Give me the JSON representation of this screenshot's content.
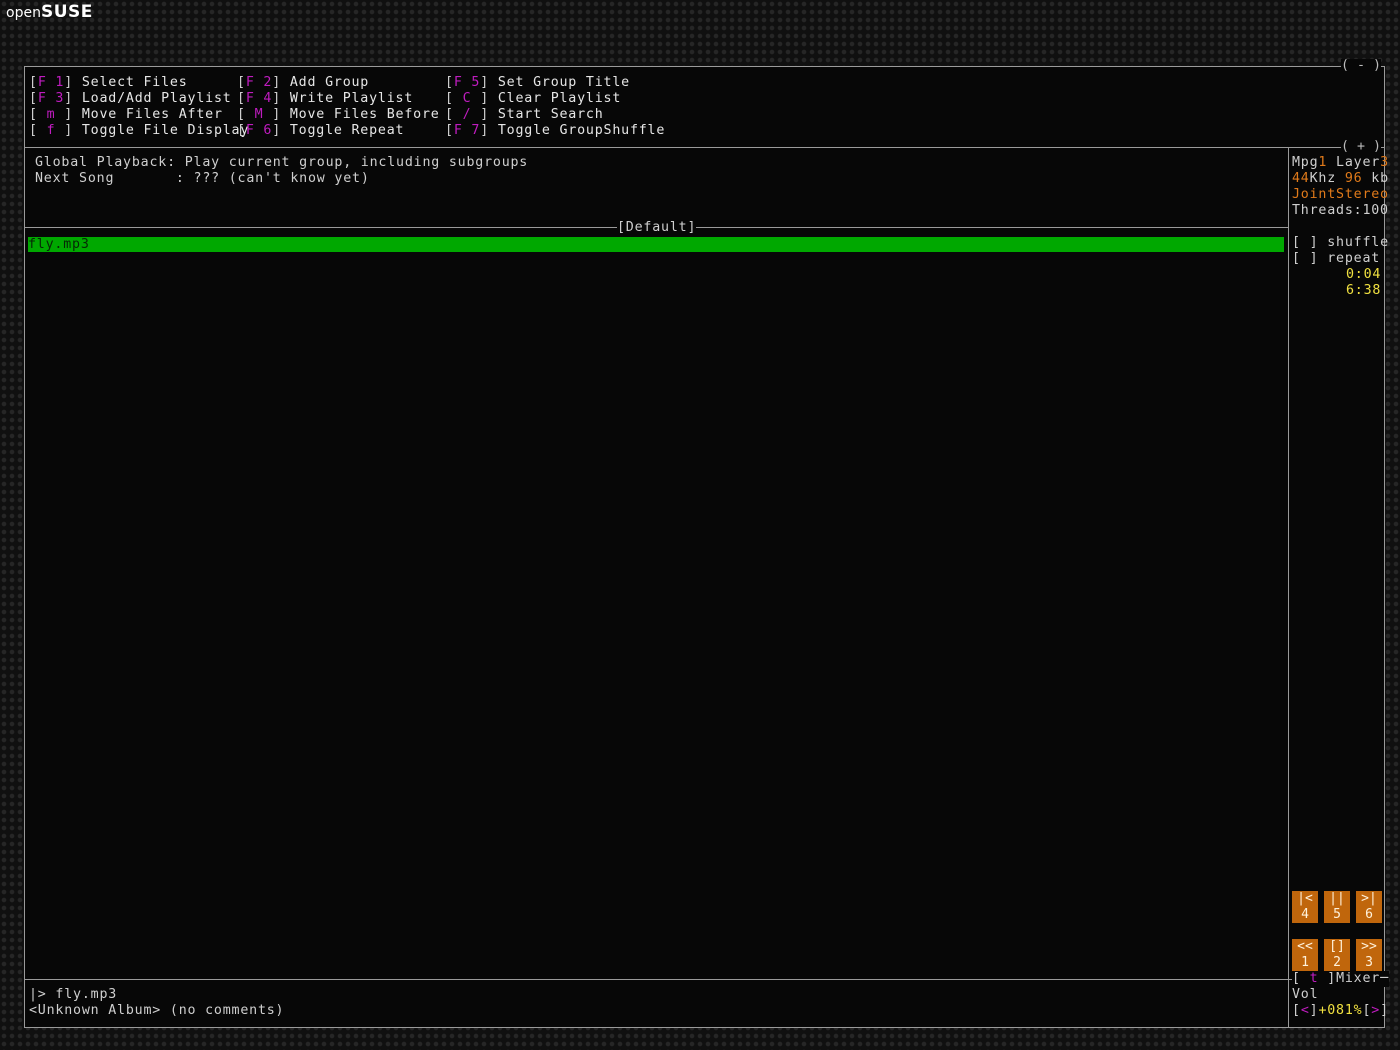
{
  "desktop": {
    "logo_prefix": "open",
    "logo_brand": "SUSE"
  },
  "window": {
    "minimize_button": "( - )",
    "maximize_button": "( + )"
  },
  "menu": [
    [
      {
        "key": "F 1",
        "label": "Select Files"
      },
      {
        "key": "F 2",
        "label": "Add Group"
      },
      {
        "key": "F 5",
        "label": "Set Group Title"
      }
    ],
    [
      {
        "key": "F 3",
        "label": "Load/Add Playlist"
      },
      {
        "key": "F 4",
        "label": "Write Playlist"
      },
      {
        "key": " C ",
        "label": "Clear Playlist"
      }
    ],
    [
      {
        "key": " m ",
        "label": "Move Files After"
      },
      {
        "key": " M ",
        "label": "Move Files Before"
      },
      {
        "key": " / ",
        "label": "Start Search"
      }
    ],
    [
      {
        "key": " f ",
        "label": "Toggle File Display"
      },
      {
        "key": "F 6",
        "label": "Toggle Repeat"
      },
      {
        "key": "F 7",
        "label": "Toggle GroupShuffle"
      }
    ]
  ],
  "status": {
    "playback_label": "Global Playback:",
    "playback_value": "Play current group, including subgroups",
    "next_label": "Next Song       :",
    "next_value": "??? (can't know yet)"
  },
  "playlist": {
    "group_title": "[Default]",
    "items": [
      {
        "name": "fly.mp3",
        "playing": true
      }
    ]
  },
  "info": {
    "mpg": "Mpg",
    "mpg_ver": "1",
    "layer": "Layer",
    "layer_num": "3",
    "khz": "44",
    "khz_unit": "Khz",
    "kbps": "96",
    "kbps_unit": "kb",
    "mode": "JointStereo",
    "threads": "Threads:100",
    "shuffle_box": "[ ]",
    "shuffle_label": "shuffle",
    "repeat_box": "[ ]",
    "repeat_label": "repeat",
    "elapsed": "0:04",
    "total": "6:38"
  },
  "controls": {
    "row_top": [
      {
        "glyph": "|<",
        "num": "4"
      },
      {
        "glyph": "||",
        "num": "5"
      },
      {
        "glyph": ">|",
        "num": "6"
      }
    ],
    "row_bottom": [
      {
        "glyph": "<<",
        "num": "1"
      },
      {
        "glyph": "[]",
        "num": "2"
      },
      {
        "glyph": ">>",
        "num": "3"
      }
    ]
  },
  "mixer": {
    "key": "t",
    "label": "Mixer",
    "vol_label": "Vol",
    "dec_key": "<",
    "volume": "+081%",
    "inc_key": ">"
  },
  "nowplaying": {
    "line1": "|> fly.mp3",
    "line2": "<Unknown Album> (no comments)"
  },
  "colors": {
    "menu_key": "#c01cc0",
    "playing_bg": "#00a800",
    "accent_orange": "#e07a1a",
    "time_yellow": "#f0e040",
    "control_bg": "#c0660c"
  }
}
